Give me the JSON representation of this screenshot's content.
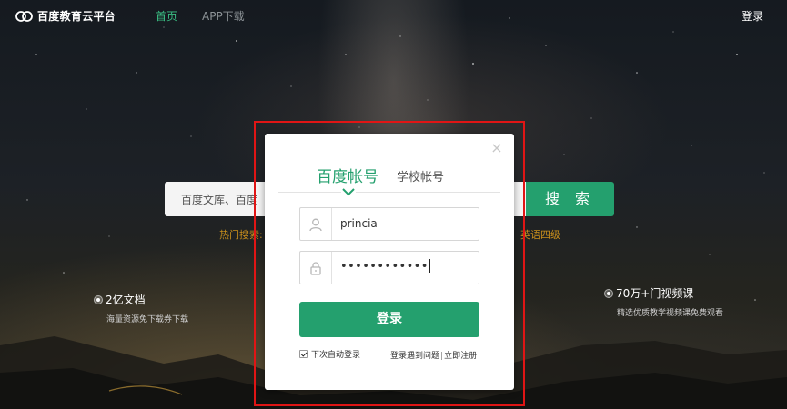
{
  "header": {
    "logo_text": "百度教育云平台",
    "nav": [
      "首页",
      "APP下载"
    ],
    "login": "登录"
  },
  "search": {
    "placeholder": "百度文库、百度",
    "button": "搜 索",
    "hot_label": "热门搜索:",
    "hot_tail": "英语四级"
  },
  "features": [
    {
      "title": "2亿文档",
      "subtitle": "海量资源免下载券下载"
    },
    {
      "title": "70万+门视频课",
      "subtitle": "精选优质教学视频课免费观看"
    }
  ],
  "dialog": {
    "close": "×",
    "tabs": [
      "百度帐号",
      "学校帐号"
    ],
    "active_tab": "百度帐号",
    "username": "princia",
    "password": "••••••••••••",
    "login_button": "登录",
    "remember_label": "下次自动登录",
    "remember_checked": true,
    "help_link": "登录遇到问题",
    "separator": "|",
    "register_link": "立即注册"
  },
  "colors": {
    "accent": "#24a06e",
    "nav_active": "#3bbf84",
    "hot_text": "#c98f1c",
    "highlight": "#e01515"
  },
  "icons": [
    "baidu-edu-logo-icon",
    "user-icon",
    "lock-icon",
    "close-icon",
    "chevron-down-icon",
    "checkbox-checked-icon"
  ]
}
